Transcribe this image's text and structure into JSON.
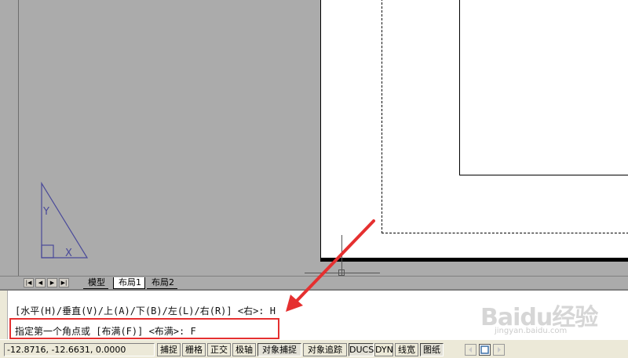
{
  "layout_tabs": {
    "nav_first": "|◀",
    "nav_prev": "◀",
    "nav_next": "▶",
    "nav_last": "▶|",
    "items": [
      {
        "label": "模型"
      },
      {
        "label": "布局1"
      },
      {
        "label": "布局2"
      }
    ],
    "active_index": 1
  },
  "command": {
    "line1": "[水平(H)/垂直(V)/上(A)/下(B)/左(L)/右(R)] <右>: H",
    "line2": "指定第一个角点或 [布满(F)] <布满>: F"
  },
  "ucs_icon": {
    "y_label": "Y",
    "x_label": "X"
  },
  "status": {
    "coords": "-12.8716, -12.6631, 0.0000",
    "buttons": [
      {
        "label": "捕捉",
        "on": false
      },
      {
        "label": "栅格",
        "on": false
      },
      {
        "label": "正交",
        "on": false
      },
      {
        "label": "极轴",
        "on": false
      },
      {
        "label": "对象捕捉",
        "on": true
      },
      {
        "label": "对象追踪",
        "on": false
      },
      {
        "label": "DUCS",
        "on": true
      },
      {
        "label": "DYN",
        "on": false
      },
      {
        "label": "线宽",
        "on": false
      },
      {
        "label": "图纸",
        "on": true
      }
    ]
  },
  "watermark": {
    "logo": "Baidu经验",
    "url": "jingyan.baidu.com"
  },
  "colors": {
    "canvas": "#ababab",
    "paper": "#ffffff",
    "highlight": "#e53030",
    "ucs": "#4a4a9a"
  }
}
